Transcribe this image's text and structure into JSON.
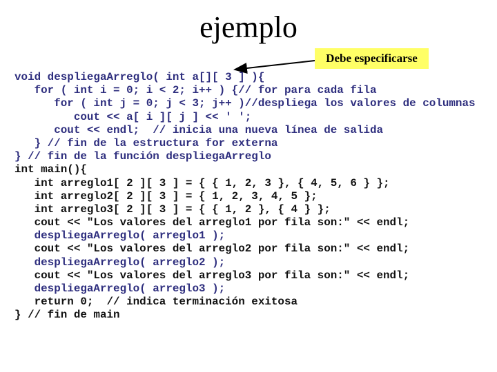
{
  "slide": {
    "title": "ejemplo",
    "callout": {
      "text": "Debe especificarse",
      "background": "#ffff66",
      "points_to": "a[][ 3 ] parameter dimension"
    },
    "colors": {
      "function_code": "#2e2e7e",
      "main_code": "#111111"
    },
    "code_lines": [
      {
        "text": "void despliegaArreglo( int a[][ 3 ] ){",
        "style": "navy"
      },
      {
        "text": "   for ( int i = 0; i < 2; i++ ) {// for para cada fila",
        "style": "navy"
      },
      {
        "text": "      for ( int j = 0; j < 3; j++ )//despliega los valores de columnas",
        "style": "navy"
      },
      {
        "text": "         cout << a[ i ][ j ] << ' ';",
        "style": "navy"
      },
      {
        "text": "      cout << endl;  // inicia una nueva línea de salida",
        "style": "navy"
      },
      {
        "text": "   } // fin de la estructura for externa",
        "style": "navy"
      },
      {
        "text": "} // fin de la función despliegaArreglo",
        "style": "navy"
      },
      {
        "text": "int main(){",
        "style": "black"
      },
      {
        "text": "   int arreglo1[ 2 ][ 3 ] = { { 1, 2, 3 }, { 4, 5, 6 } };",
        "style": "black"
      },
      {
        "text": "   int arreglo2[ 2 ][ 3 ] = { 1, 2, 3, 4, 5 };",
        "style": "black"
      },
      {
        "text": "   int arreglo3[ 2 ][ 3 ] = { { 1, 2 }, { 4 } };",
        "style": "black"
      },
      {
        "text": "   cout << \"Los valores del arreglo1 por fila son:\" << endl;",
        "style": "black"
      },
      {
        "text": "   despliegaArreglo( arreglo1 );",
        "style": "navy"
      },
      {
        "text": "   cout << \"Los valores del arreglo2 por fila son:\" << endl;",
        "style": "black"
      },
      {
        "text": "   despliegaArreglo( arreglo2 );",
        "style": "navy"
      },
      {
        "text": "   cout << \"Los valores del arreglo3 por fila son:\" << endl;",
        "style": "black"
      },
      {
        "text": "   despliegaArreglo( arreglo3 );",
        "style": "navy"
      },
      {
        "text": "   return 0;  // indica terminación exitosa",
        "style": "black"
      },
      {
        "text": "} // fin de main",
        "style": "black"
      }
    ]
  }
}
